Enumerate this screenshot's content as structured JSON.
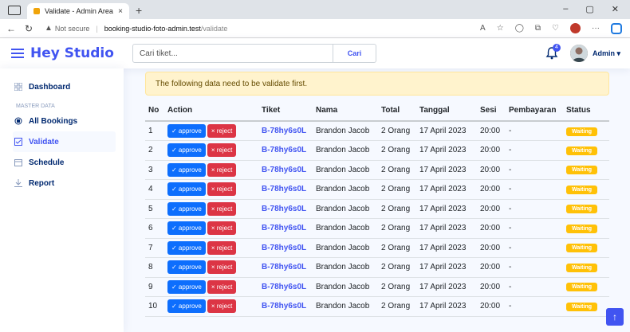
{
  "browser": {
    "tab_title": "Validate - Admin Area",
    "tab_close": "×",
    "new_tab": "+",
    "not_secure": "Not secure",
    "url_host": "booking-studio-foto-admin.test",
    "url_path": "/validate"
  },
  "header": {
    "brand": "Hey Studio",
    "search_placeholder": "Cari tiket...",
    "search_button": "Cari",
    "notif_count": "4",
    "user_name": "Admin ▾"
  },
  "sidebar": {
    "items": [
      {
        "label": "Dashboard"
      },
      {
        "label": "All Bookings"
      },
      {
        "label": "Validate"
      },
      {
        "label": "Schedule"
      },
      {
        "label": "Report"
      }
    ],
    "heading": "MASTER DATA"
  },
  "main": {
    "alert": "The following data need to be validate first.",
    "columns": [
      "No",
      "Action",
      "Tiket",
      "Nama",
      "Total",
      "Tanggal",
      "Sesi",
      "Pembayaran",
      "Status"
    ],
    "approve_label": "✓ approve",
    "reject_label": "× reject",
    "rows": [
      {
        "no": "1",
        "tiket": "B-78hy6s0L",
        "nama": "Brandon Jacob",
        "total": "2 Orang",
        "tanggal": "17 April 2023",
        "sesi": "20:00",
        "pembayaran": "-",
        "status": "Waiting"
      },
      {
        "no": "2",
        "tiket": "B-78hy6s0L",
        "nama": "Brandon Jacob",
        "total": "2 Orang",
        "tanggal": "17 April 2023",
        "sesi": "20:00",
        "pembayaran": "-",
        "status": "Waiting"
      },
      {
        "no": "3",
        "tiket": "B-78hy6s0L",
        "nama": "Brandon Jacob",
        "total": "2 Orang",
        "tanggal": "17 April 2023",
        "sesi": "20:00",
        "pembayaran": "-",
        "status": "Waiting"
      },
      {
        "no": "4",
        "tiket": "B-78hy6s0L",
        "nama": "Brandon Jacob",
        "total": "2 Orang",
        "tanggal": "17 April 2023",
        "sesi": "20:00",
        "pembayaran": "-",
        "status": "Waiting"
      },
      {
        "no": "5",
        "tiket": "B-78hy6s0L",
        "nama": "Brandon Jacob",
        "total": "2 Orang",
        "tanggal": "17 April 2023",
        "sesi": "20:00",
        "pembayaran": "-",
        "status": "Waiting"
      },
      {
        "no": "6",
        "tiket": "B-78hy6s0L",
        "nama": "Brandon Jacob",
        "total": "2 Orang",
        "tanggal": "17 April 2023",
        "sesi": "20:00",
        "pembayaran": "-",
        "status": "Waiting"
      },
      {
        "no": "7",
        "tiket": "B-78hy6s0L",
        "nama": "Brandon Jacob",
        "total": "2 Orang",
        "tanggal": "17 April 2023",
        "sesi": "20:00",
        "pembayaran": "-",
        "status": "Waiting"
      },
      {
        "no": "8",
        "tiket": "B-78hy6s0L",
        "nama": "Brandon Jacob",
        "total": "2 Orang",
        "tanggal": "17 April 2023",
        "sesi": "20:00",
        "pembayaran": "-",
        "status": "Waiting"
      },
      {
        "no": "9",
        "tiket": "B-78hy6s0L",
        "nama": "Brandon Jacob",
        "total": "2 Orang",
        "tanggal": "17 April 2023",
        "sesi": "20:00",
        "pembayaran": "-",
        "status": "Waiting"
      },
      {
        "no": "10",
        "tiket": "B-78hy6s0L",
        "nama": "Brandon Jacob",
        "total": "2 Orang",
        "tanggal": "17 April 2023",
        "sesi": "20:00",
        "pembayaran": "-",
        "status": "Waiting"
      }
    ]
  },
  "colors": {
    "brand": "#4154f1",
    "approve": "#0d6efd",
    "reject": "#dc3545",
    "waiting": "#ffc107",
    "alert_bg": "#fff3cd"
  }
}
